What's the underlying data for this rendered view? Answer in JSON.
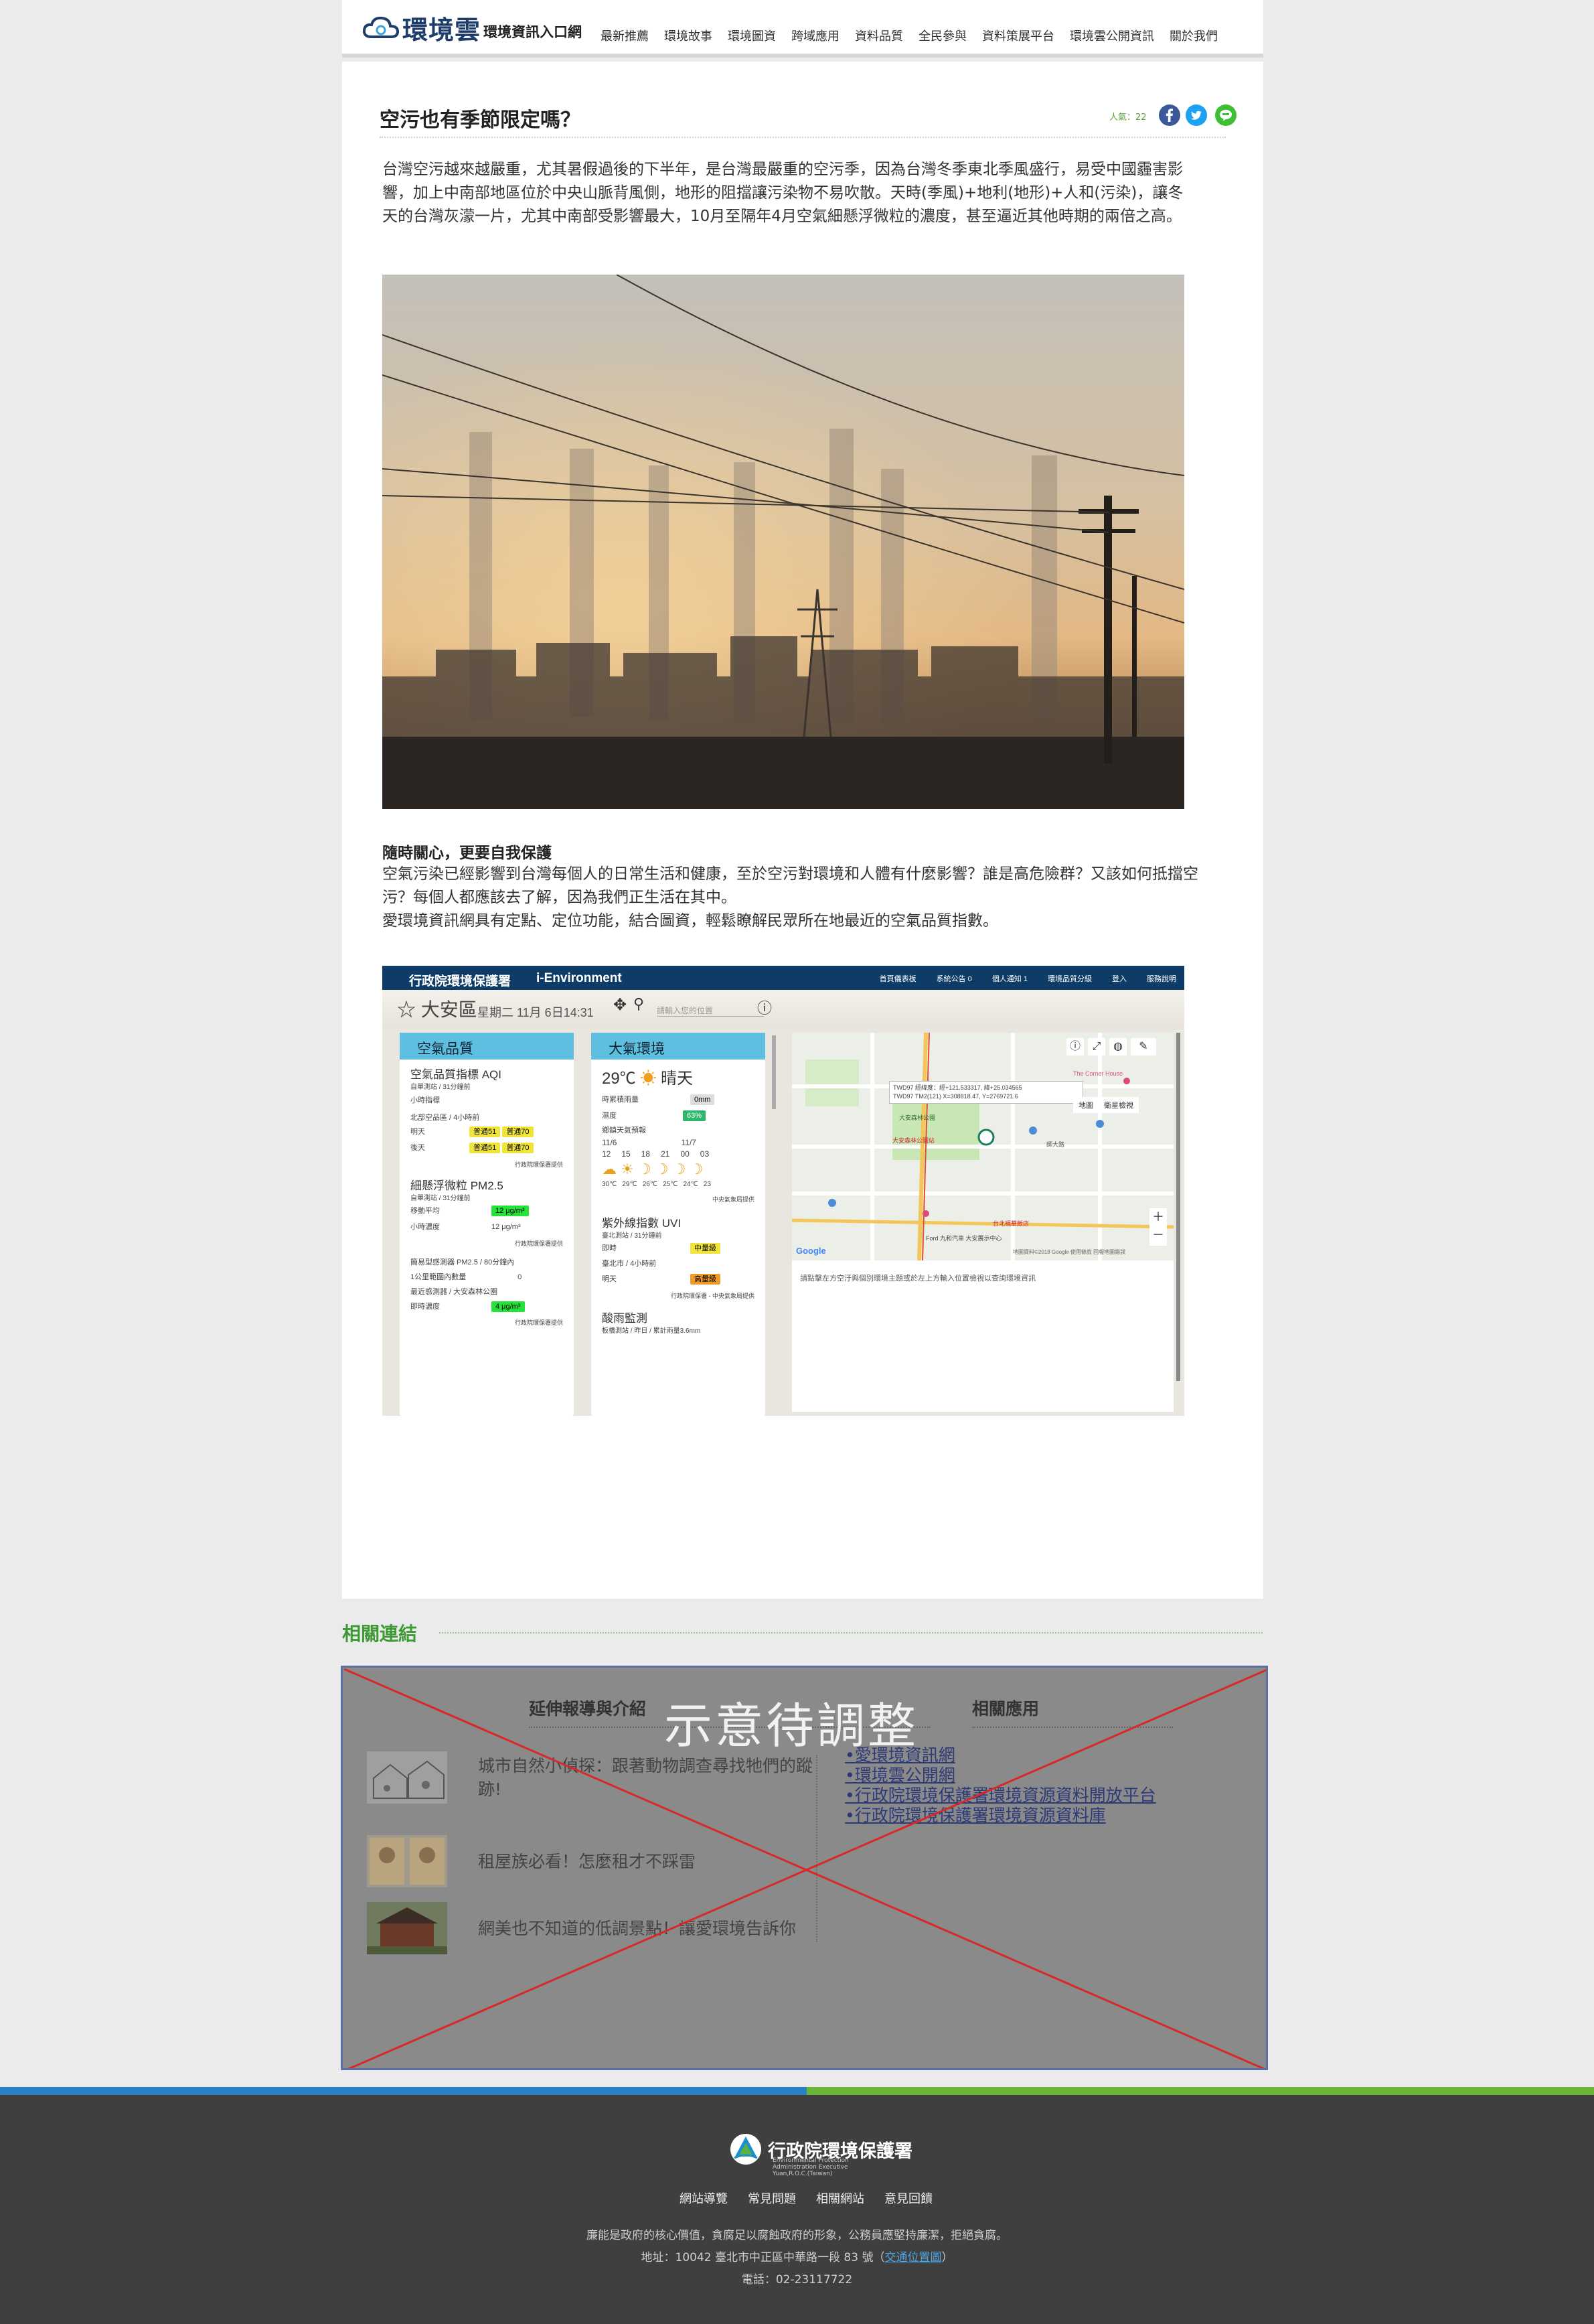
{
  "header": {
    "logo_title": "環境雲",
    "logo_subtitle": "環境資訊入口網",
    "nav": [
      "最新推薦",
      "環境故事",
      "環境圖資",
      "跨域應用",
      "資料品質",
      "全民參與",
      "資料策展平台",
      "環境雲公開資訊",
      "關於我們"
    ]
  },
  "article": {
    "title": "空污也有季節限定嗎？",
    "views": "人氣：22",
    "paragraph1": "台灣空污越來越嚴重，尤其暑假過後的下半年，是台灣最嚴重的空污季，因為台灣冬季東北季風盛行，易受中國霾害影響，加上中南部地區位於中央山脈背風側，地形的阻擋讓污染物不易吹散。天時(季風)+地利(地形)+人和(污染)，讓冬天的台灣灰濛一片，尤其中南部受影響最大，10月至隔年4月空氣細懸浮微粒的濃度，甚至逼近其他時期的兩倍之高。",
    "subheading": "隨時關心，更要自我保護",
    "paragraph2": [
      "空氣污染已經影響到台灣每個人的日常生活和健康，至於空污對環境和人體有什麼影響？誰是高危險群？又該如何抵擋空污？每個人都應該去了解，因為我們正生活在其中。",
      "愛環境資訊網具有定點、定位功能，結合圖資，輕鬆瞭解民眾所在地最近的空氣品質指數。"
    ]
  },
  "screenshot": {
    "agency": "行政院環境保護署",
    "site": "i-Environment",
    "top_links": [
      "首頁儀表板",
      "系統公告 0",
      "個人通知 1",
      "環境品質分級",
      "登入",
      "服務說明"
    ],
    "district": "大安區",
    "date": "星期二 11月 6日14:31",
    "search_placeholder": "請輸入您的位置",
    "air_panel": {
      "title": "空氣品質",
      "aqi_label": "空氣品質指標 AQI",
      "aqi_sub": "自單測站 / 31分鐘前",
      "hourly": "小時指標",
      "forecast_label": "北部空品區 / 4小時前",
      "today": "明天",
      "today_pill1": "普通51",
      "today_pill2": "普通70",
      "after": "後天",
      "after_pill1": "普通51",
      "after_pill2": "普通70",
      "source": "行政院環保署提供",
      "pm_label": "細懸浮微粒 PM2.5",
      "pm_sub": "自單測站 / 31分鐘前",
      "pm_row1": "移動平均",
      "pm_row1_val": "12 μg/m³",
      "pm_row2": "小時濃度",
      "pm_row2_val": "12 μg/m³",
      "pm_source": "行政院環保署提供",
      "sensor_label": "簡易型感測器 PM2.5 / 80分鐘內",
      "sensor_row": "1公里範圍內數量",
      "sensor_val": "0",
      "near_label": "最近感測器 / 大安森林公園",
      "near_row": "即時濃度",
      "near_val": "4 μg/m³",
      "near_source": "行政院環保署提供"
    },
    "weather_panel": {
      "title": "大氣環境",
      "temp": "29℃",
      "cond": "晴天",
      "rain_label": "時累積雨量",
      "rain_val": "0mm",
      "humid_label": "濕度",
      "humid_val": "63%",
      "fc_label": "鄉鎮天氣預報",
      "fc_days": [
        "11/6",
        "11/7"
      ],
      "fc_hours": [
        "12",
        "15",
        "18",
        "21",
        "00",
        "03"
      ],
      "fc_temps": [
        "30℃",
        "29℃",
        "26℃",
        "25℃",
        "24℃",
        "23"
      ],
      "fc_source": "中央氣象局提供",
      "uvi_label": "紫外線指數 UVI",
      "uvi_sub": "臺北測站 / 31分鐘前",
      "uvi_row": "即時",
      "uvi_val": "中量級",
      "uvi_fc_label": "臺北市 / 4小時前",
      "uvi_fc_row": "明天",
      "uvi_fc_val": "高量級",
      "uvi_source": "行政院環保署 - 中央氣象局提供",
      "acid_label": "酸雨監測",
      "acid_sub": "板橋測站 / 昨日 / 累計雨量3.6mm"
    },
    "map": {
      "popup_title": "TWD97 經緯度：經+121.533317, 緯+25.034565",
      "popup_sub": "TWD97 TM2(121) X=308818.47, Y=2769721.6",
      "tab_map": "地圖",
      "tab_sat": "衛星檢視",
      "labels": [
        "大安森林公園",
        "大安森林公園站",
        "師大路",
        "Ford 九和汽車 大安展示中心",
        "台北福華飯店",
        "The Corner House"
      ],
      "credit": "地圖資料©2018 Google  使用條款  回報地圖錯誤",
      "note": "請點擊左方空汙與個別環境主題或於左上方輸入位置檢視以查詢環境資訊"
    }
  },
  "related": {
    "section_title": "相關連結",
    "col1_title": "延伸報導與介紹",
    "col2_title": "相關應用",
    "mock_label": "示意待調整",
    "stories": [
      "城市自然小偵探：跟著動物調查尋找牠們的蹤跡!",
      "租屋族必看！怎麼租才不踩雷",
      "網美也不知道的低調景點！讓愛環境告訴你"
    ],
    "apps": [
      "•愛環境資訊網",
      "•環境雲公開網",
      "•行政院環境保護署環境資源資料開放平台",
      "•行政院環境保護署環境資源資料庫"
    ]
  },
  "footer": {
    "agency": "行政院環境保護署",
    "agency_en": "Environmental Protection Administration Executive Yuan,R.O.C.(Taiwan)",
    "links": [
      "網站導覽",
      "常見問題",
      "相關網站",
      "意見回饋"
    ],
    "line1": "廉能是政府的核心價值，貪腐足以腐蝕政府的形象，公務員應堅持廉潔，拒絕貪腐。",
    "line2_pre": "地址：10042 臺北市中正區中華路一段 83 號（",
    "line2_link": "交通位置圖",
    "line2_post": "）",
    "line3": "電話：02-23117722"
  },
  "colors": {
    "brand_green": "#3f9a35",
    "brand_blue": "#1e3d6b",
    "footer_bg": "#3f3f3f",
    "strip_blue": "#2b80c3",
    "strip_green": "#6ab43a",
    "x_red": "#d82828"
  }
}
